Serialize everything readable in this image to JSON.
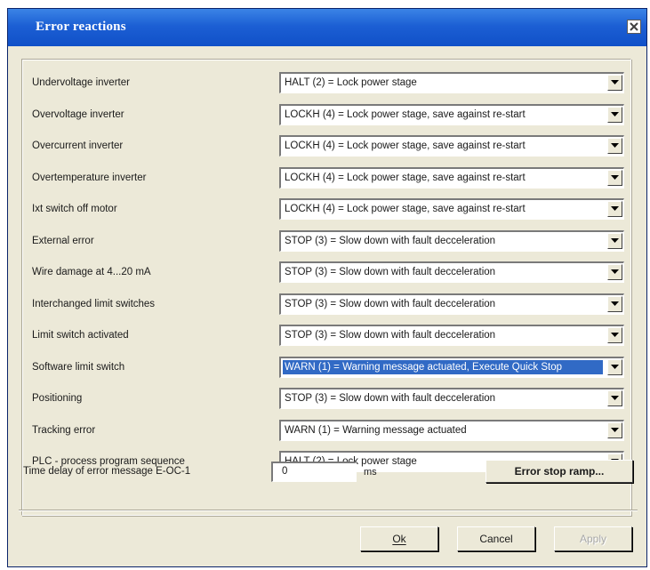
{
  "window": {
    "title": "Error reactions"
  },
  "rows": [
    {
      "label": "Undervoltage inverter",
      "value": "HALT (2) = Lock power stage"
    },
    {
      "label": "Overvoltage inverter",
      "value": "LOCKH (4) = Lock power stage, save against re-start"
    },
    {
      "label": "Overcurrent inverter",
      "value": "LOCKH (4) = Lock power stage, save against re-start"
    },
    {
      "label": "Overtemperature inverter",
      "value": "LOCKH (4) = Lock power stage, save against re-start"
    },
    {
      "label": "Ixt switch off motor",
      "value": "LOCKH (4) = Lock power stage, save against re-start"
    },
    {
      "label": "External error",
      "value": "STOP (3) = Slow down with fault decceleration"
    },
    {
      "label": "Wire damage at 4...20 mA",
      "value": "STOP (3) = Slow down with fault decceleration"
    },
    {
      "label": "Interchanged limit switches",
      "value": "STOP (3) = Slow down with fault decceleration"
    },
    {
      "label": "Limit switch activated",
      "value": "STOP (3) = Slow down with fault decceleration"
    },
    {
      "label": "Software limit switch",
      "value": "WARN (1) = Warning message actuated, Execute Quick Stop"
    },
    {
      "label": "Positioning",
      "value": "STOP (3) = Slow down with fault decceleration"
    },
    {
      "label": "Tracking error",
      "value": "WARN (1) = Warning message actuated"
    },
    {
      "label": "PLC - process program sequence",
      "value": "HALT (2) = Lock power stage"
    }
  ],
  "selected_row": 9,
  "delay": {
    "label": "Time delay of error message E-OC-1",
    "value": "0",
    "unit": "ms"
  },
  "buttons": {
    "error_stop_ramp": "Error stop ramp...",
    "ok": "Ok",
    "cancel": "Cancel",
    "apply": "Apply"
  },
  "colors": {
    "title_bar": "#1c5fd4",
    "selection": "#316ac5",
    "dialog_bg": "#ece9d8"
  },
  "icons": {
    "close": "close-icon",
    "dropdown": "chevron-down-icon"
  }
}
